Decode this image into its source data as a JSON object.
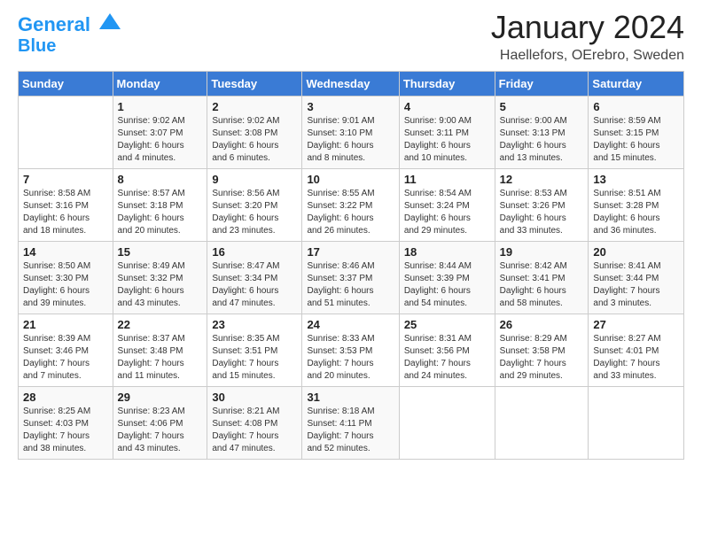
{
  "header": {
    "logo_line1": "General",
    "logo_line2": "Blue",
    "month": "January 2024",
    "location": "Haellefors, OErebro, Sweden"
  },
  "weekdays": [
    "Sunday",
    "Monday",
    "Tuesday",
    "Wednesday",
    "Thursday",
    "Friday",
    "Saturday"
  ],
  "weeks": [
    [
      {
        "day": "",
        "info": ""
      },
      {
        "day": "1",
        "info": "Sunrise: 9:02 AM\nSunset: 3:07 PM\nDaylight: 6 hours\nand 4 minutes."
      },
      {
        "day": "2",
        "info": "Sunrise: 9:02 AM\nSunset: 3:08 PM\nDaylight: 6 hours\nand 6 minutes."
      },
      {
        "day": "3",
        "info": "Sunrise: 9:01 AM\nSunset: 3:10 PM\nDaylight: 6 hours\nand 8 minutes."
      },
      {
        "day": "4",
        "info": "Sunrise: 9:00 AM\nSunset: 3:11 PM\nDaylight: 6 hours\nand 10 minutes."
      },
      {
        "day": "5",
        "info": "Sunrise: 9:00 AM\nSunset: 3:13 PM\nDaylight: 6 hours\nand 13 minutes."
      },
      {
        "day": "6",
        "info": "Sunrise: 8:59 AM\nSunset: 3:15 PM\nDaylight: 6 hours\nand 15 minutes."
      }
    ],
    [
      {
        "day": "7",
        "info": "Sunrise: 8:58 AM\nSunset: 3:16 PM\nDaylight: 6 hours\nand 18 minutes."
      },
      {
        "day": "8",
        "info": "Sunrise: 8:57 AM\nSunset: 3:18 PM\nDaylight: 6 hours\nand 20 minutes."
      },
      {
        "day": "9",
        "info": "Sunrise: 8:56 AM\nSunset: 3:20 PM\nDaylight: 6 hours\nand 23 minutes."
      },
      {
        "day": "10",
        "info": "Sunrise: 8:55 AM\nSunset: 3:22 PM\nDaylight: 6 hours\nand 26 minutes."
      },
      {
        "day": "11",
        "info": "Sunrise: 8:54 AM\nSunset: 3:24 PM\nDaylight: 6 hours\nand 29 minutes."
      },
      {
        "day": "12",
        "info": "Sunrise: 8:53 AM\nSunset: 3:26 PM\nDaylight: 6 hours\nand 33 minutes."
      },
      {
        "day": "13",
        "info": "Sunrise: 8:51 AM\nSunset: 3:28 PM\nDaylight: 6 hours\nand 36 minutes."
      }
    ],
    [
      {
        "day": "14",
        "info": "Sunrise: 8:50 AM\nSunset: 3:30 PM\nDaylight: 6 hours\nand 39 minutes."
      },
      {
        "day": "15",
        "info": "Sunrise: 8:49 AM\nSunset: 3:32 PM\nDaylight: 6 hours\nand 43 minutes."
      },
      {
        "day": "16",
        "info": "Sunrise: 8:47 AM\nSunset: 3:34 PM\nDaylight: 6 hours\nand 47 minutes."
      },
      {
        "day": "17",
        "info": "Sunrise: 8:46 AM\nSunset: 3:37 PM\nDaylight: 6 hours\nand 51 minutes."
      },
      {
        "day": "18",
        "info": "Sunrise: 8:44 AM\nSunset: 3:39 PM\nDaylight: 6 hours\nand 54 minutes."
      },
      {
        "day": "19",
        "info": "Sunrise: 8:42 AM\nSunset: 3:41 PM\nDaylight: 6 hours\nand 58 minutes."
      },
      {
        "day": "20",
        "info": "Sunrise: 8:41 AM\nSunset: 3:44 PM\nDaylight: 7 hours\nand 3 minutes."
      }
    ],
    [
      {
        "day": "21",
        "info": "Sunrise: 8:39 AM\nSunset: 3:46 PM\nDaylight: 7 hours\nand 7 minutes."
      },
      {
        "day": "22",
        "info": "Sunrise: 8:37 AM\nSunset: 3:48 PM\nDaylight: 7 hours\nand 11 minutes."
      },
      {
        "day": "23",
        "info": "Sunrise: 8:35 AM\nSunset: 3:51 PM\nDaylight: 7 hours\nand 15 minutes."
      },
      {
        "day": "24",
        "info": "Sunrise: 8:33 AM\nSunset: 3:53 PM\nDaylight: 7 hours\nand 20 minutes."
      },
      {
        "day": "25",
        "info": "Sunrise: 8:31 AM\nSunset: 3:56 PM\nDaylight: 7 hours\nand 24 minutes."
      },
      {
        "day": "26",
        "info": "Sunrise: 8:29 AM\nSunset: 3:58 PM\nDaylight: 7 hours\nand 29 minutes."
      },
      {
        "day": "27",
        "info": "Sunrise: 8:27 AM\nSunset: 4:01 PM\nDaylight: 7 hours\nand 33 minutes."
      }
    ],
    [
      {
        "day": "28",
        "info": "Sunrise: 8:25 AM\nSunset: 4:03 PM\nDaylight: 7 hours\nand 38 minutes."
      },
      {
        "day": "29",
        "info": "Sunrise: 8:23 AM\nSunset: 4:06 PM\nDaylight: 7 hours\nand 43 minutes."
      },
      {
        "day": "30",
        "info": "Sunrise: 8:21 AM\nSunset: 4:08 PM\nDaylight: 7 hours\nand 47 minutes."
      },
      {
        "day": "31",
        "info": "Sunrise: 8:18 AM\nSunset: 4:11 PM\nDaylight: 7 hours\nand 52 minutes."
      },
      {
        "day": "",
        "info": ""
      },
      {
        "day": "",
        "info": ""
      },
      {
        "day": "",
        "info": ""
      }
    ]
  ]
}
